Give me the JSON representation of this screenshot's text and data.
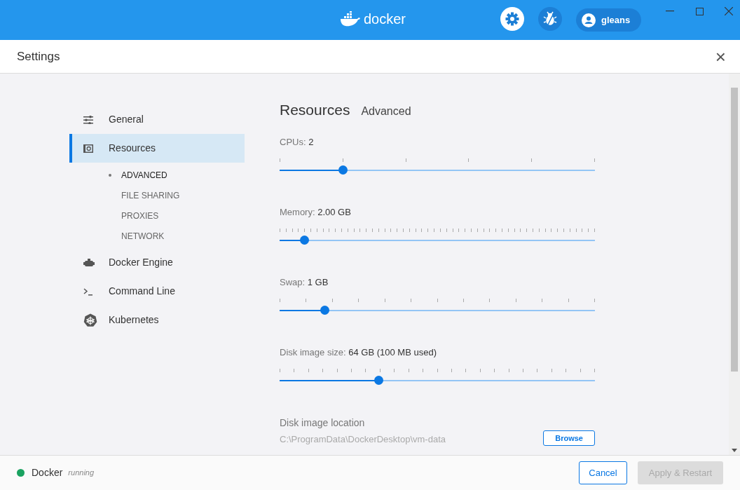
{
  "title_bar": {
    "logo_text": "docker",
    "user": "gleans",
    "settings_active": true
  },
  "header": {
    "title": "Settings",
    "close": "×"
  },
  "sidebar": {
    "items": [
      {
        "label": "General",
        "selected": false
      },
      {
        "label": "Resources",
        "selected": true,
        "children": [
          {
            "label": "ADVANCED",
            "selected": true
          },
          {
            "label": "FILE SHARING",
            "selected": false
          },
          {
            "label": "PROXIES",
            "selected": false
          },
          {
            "label": "NETWORK",
            "selected": false
          }
        ]
      },
      {
        "label": "Docker Engine",
        "selected": false
      },
      {
        "label": "Command Line",
        "selected": false
      },
      {
        "label": "Kubernetes",
        "selected": false
      }
    ]
  },
  "content": {
    "heading": "Resources",
    "subheading": "Advanced",
    "sliders": [
      {
        "label": "CPUs:",
        "value": "2",
        "level": 0.2
      },
      {
        "label": "Memory:",
        "value": "2.00 GB",
        "level": 0.078
      },
      {
        "label": "Swap:",
        "value": "1 GB",
        "level": 0.142
      },
      {
        "label": "Disk image size:",
        "value": "64 GB (100 MB used)",
        "level": 0.313
      }
    ],
    "disk_location": {
      "label": "Disk image location",
      "path": "C:\\ProgramData\\DockerDesktop\\vm-data",
      "button": "Browse"
    }
  },
  "footer": {
    "app": "Docker",
    "status": {
      "text": "running",
      "color": "#1aa260"
    },
    "buttons": [
      {
        "label": "Cancel",
        "disabled": false
      },
      {
        "label": "Apply & Restart",
        "disabled": true
      }
    ]
  }
}
